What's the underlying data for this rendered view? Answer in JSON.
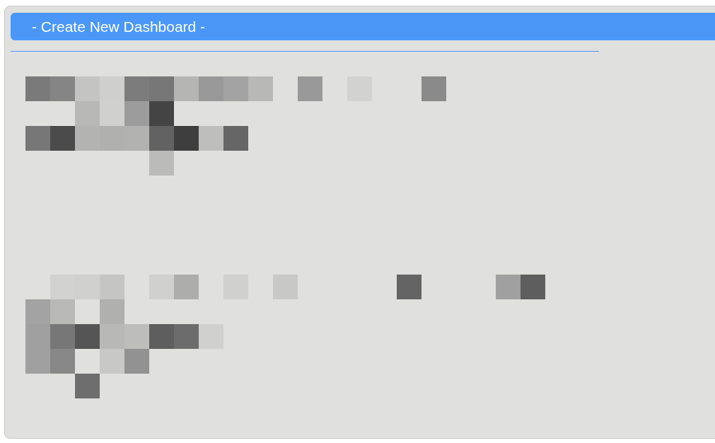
{
  "menu": {
    "items": [
      {
        "label": "- Create New Dashboard -",
        "selected": true
      }
    ]
  }
}
